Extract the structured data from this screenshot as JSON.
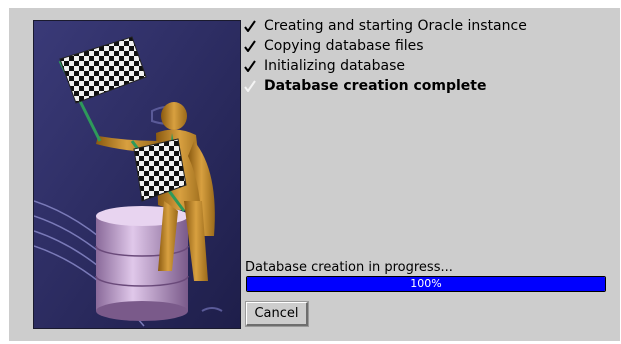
{
  "steps": [
    {
      "label": "Creating and starting Oracle instance",
      "done": true,
      "current": false
    },
    {
      "label": "Copying database files",
      "done": true,
      "current": false
    },
    {
      "label": "Initializing database",
      "done": true,
      "current": false
    },
    {
      "label": "Database creation complete",
      "done": true,
      "current": true
    }
  ],
  "status": {
    "text": "Database creation in progress...",
    "progress_label": "100%",
    "progress": 1.0
  },
  "buttons": {
    "cancel_label": "Cancel"
  },
  "colors": {
    "dialog_bg": "#cdcdcd",
    "progress_fill": "#0000ff",
    "illustration_bg": "#2d2d66"
  },
  "icons": {
    "step_done": "checkmark-icon",
    "illustration": "figure-with-checkered-flags-on-database-stack"
  }
}
